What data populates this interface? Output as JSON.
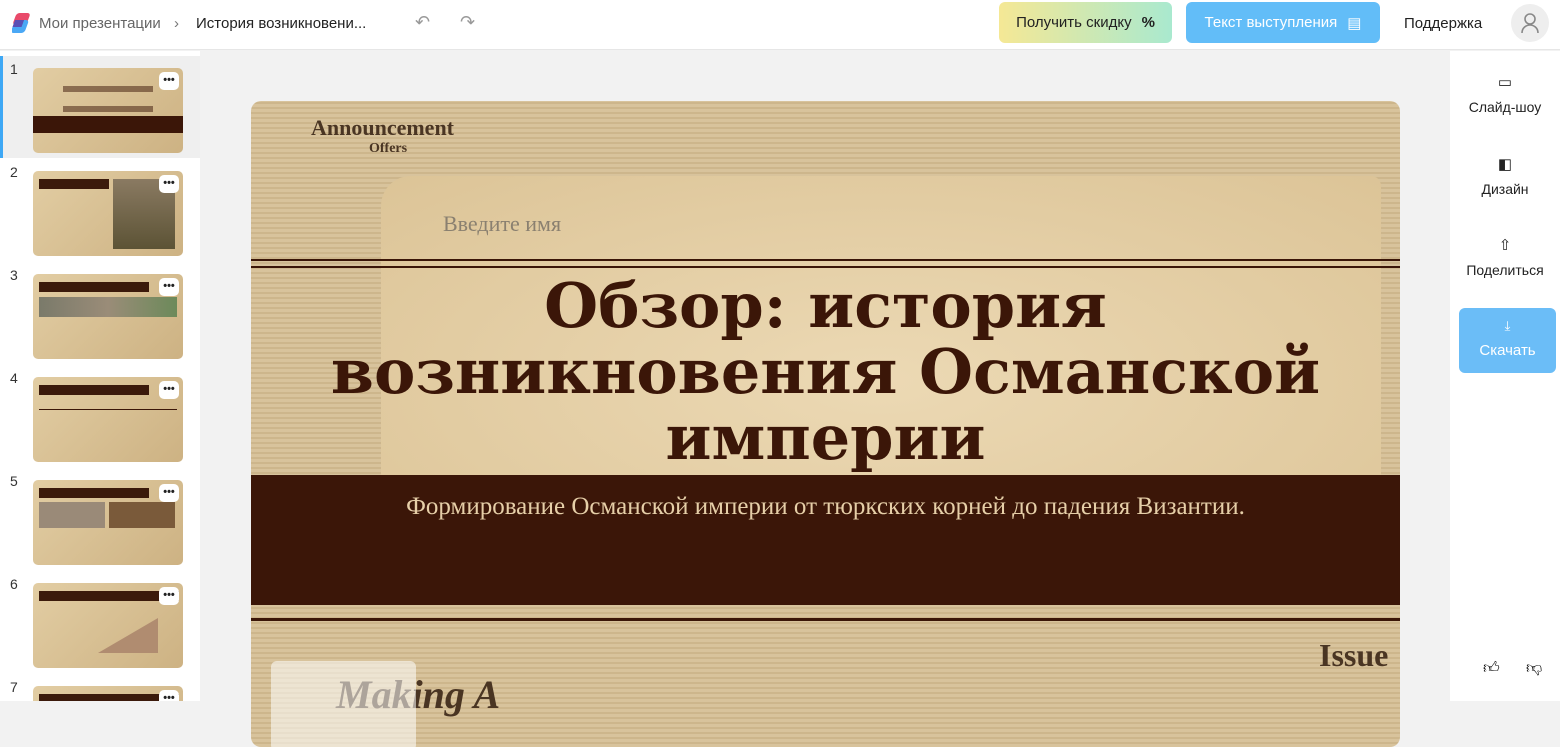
{
  "header": {
    "breadcrumb_root": "Мои презентации",
    "breadcrumb_sep": "›",
    "doc_title": "История возникновени...",
    "discount_label": "Получить скидку",
    "discount_icon": "%",
    "speech_label": "Текст выступления",
    "support_label": "Поддержка"
  },
  "slides": [
    {
      "num": "1"
    },
    {
      "num": "2"
    },
    {
      "num": "3"
    },
    {
      "num": "4"
    },
    {
      "num": "5"
    },
    {
      "num": "6"
    },
    {
      "num": "7"
    }
  ],
  "more_label": "•••",
  "right_panel": {
    "slideshow": "Слайд-шоу",
    "design": "Дизайн",
    "share": "Поделиться",
    "download": "Скачать"
  },
  "slide": {
    "name_placeholder": "Введите имя",
    "title": "Обзор: история возникновения Османской империи",
    "subtitle": "Формирование Османской империи от тюркских корней до падения Византии.",
    "deco_announcement": "Announcement",
    "deco_offers": "Offers",
    "deco_issue": "Issue",
    "deco_making": "Making A"
  },
  "colors": {
    "accent": "#62bdf8",
    "slide_dark": "#3b1608",
    "slide_paper": "#e4cfa6"
  }
}
